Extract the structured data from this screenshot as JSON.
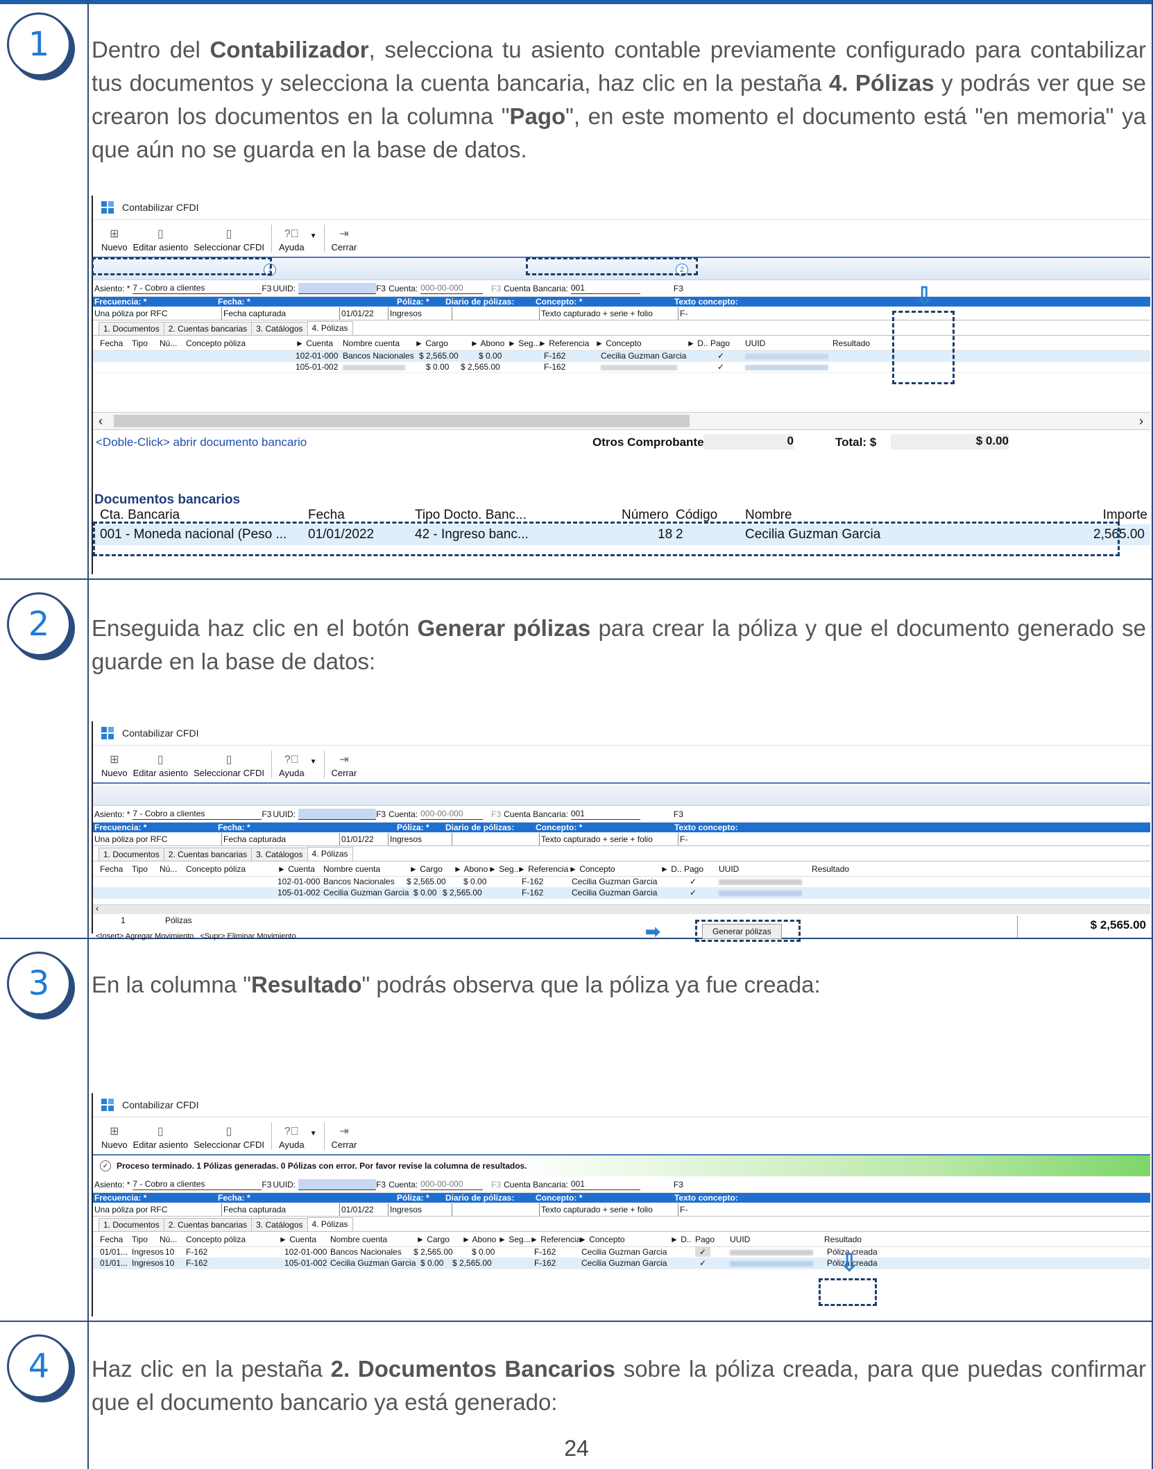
{
  "steps": [
    {
      "num": "1",
      "text_parts": [
        "Dentro del ",
        "Contabilizador",
        ", selecciona tu asiento contable previamente configurado para contabilizar tus documentos y selecciona la cuenta bancaria, haz clic en la pestaña ",
        "4. Pólizas",
        " y podrás ver que se crearon los documentos en la columna \"",
        "Pago",
        "\", en este momento el documento está \"en memoria\" ya que aún no se guarda en la base de datos."
      ]
    },
    {
      "num": "2",
      "text_parts": [
        " Enseguida haz clic en el botón ",
        "Generar pólizas",
        " para crear la póliza y que el documento generado se guarde en la base de datos:"
      ]
    },
    {
      "num": "3",
      "text_parts": [
        "En la columna \"",
        "Resultado",
        "\" podrás observa que la póliza ya fue creada:"
      ]
    },
    {
      "num": "4",
      "text_parts": [
        "Haz clic en la pestaña ",
        "2. Documentos Bancarios",
        " sobre la póliza creada, para que puedas confirmar que el documento bancario ya está generado:"
      ]
    }
  ],
  "page_number": "24",
  "window": {
    "title": "Contabilizar CFDI",
    "toolbar": [
      "Nuevo",
      "Editar asiento",
      "Seleccionar CFDI",
      "Ayuda",
      "Cerrar"
    ],
    "asiento_label": "Asiento: *",
    "asiento_value": "7 - Cobro a clientes",
    "f3": "F3",
    "uuid_label": "UUID:",
    "cuenta_label": "Cuenta:",
    "cuenta_value": "000-00-000",
    "cta_bancaria_label": "Cuenta Bancaria:",
    "cta_bancaria_value": "001",
    "hdr": [
      "Frecuencia: *",
      "Fecha: *",
      "Póliza: *",
      "Diario de pólizas:",
      "Concepto: *",
      "Texto concepto:"
    ],
    "frecuencia": "Una póliza por RFC",
    "fecha": "Fecha capturada",
    "fecha_val": "01/01/22",
    "poliza": "Ingresos",
    "concepto": "Texto capturado + serie + folio",
    "texto": "F-",
    "tabs": [
      "1. Documentos",
      "2. Cuentas bancarias",
      "3. Catálogos",
      "4. Pólizas"
    ],
    "cols": [
      "Fecha",
      "Tipo",
      "Nú...",
      "Concepto póliza",
      "► Cuenta",
      "Nombre cuenta",
      "► Cargo",
      "► Abono",
      "► Seg...",
      "► Referencia",
      "► Concepto",
      "► D..",
      "Pago",
      "UUID",
      "Resultado"
    ],
    "check": "✓",
    "rows1": [
      {
        "cuenta": "102-01-000",
        "nombre": "Bancos Nacionales",
        "cargo": "$ 2,565.00",
        "abono": "$ 0.00",
        "ref": "F-162",
        "concepto": "Cecilia Guzman Garcia"
      },
      {
        "cuenta": "105-01-002",
        "nombre": "",
        "cargo": "$ 0.00",
        "abono": "$ 2,565.00",
        "ref": "F-162",
        "concepto": ""
      }
    ],
    "rows2": [
      {
        "cuenta": "102-01-000",
        "nombre": "Bancos Nacionales",
        "cargo": "$ 2,565.00",
        "abono": "$ 0.00",
        "ref": "F-162",
        "concepto": "Cecilia Guzman Garcia"
      },
      {
        "cuenta": "105-01-002",
        "nombre": "Cecilia Guzman Garcia",
        "cargo": "$ 0.00",
        "abono": "$ 2,565.00",
        "ref": "F-162",
        "concepto": "Cecilia Guzman Garcia"
      }
    ],
    "rows3": [
      {
        "fecha": "01/01...",
        "tipo": "Ingresos",
        "num": "10",
        "cpol": "F-162",
        "cuenta": "102-01-000",
        "nombre": "Bancos Nacionales",
        "cargo": "$ 2,565.00",
        "abono": "$ 0.00",
        "ref": "F-162",
        "concepto": "Cecilia Guzman Garcia",
        "resultado": "Póliza creada"
      },
      {
        "fecha": "01/01...",
        "tipo": "Ingresos",
        "num": "10",
        "cpol": "F-162",
        "cuenta": "105-01-002",
        "nombre": "Cecilia Guzman Garcia",
        "cargo": "$ 0.00",
        "abono": "$ 2,565.00",
        "ref": "F-162",
        "concepto": "Cecilia Guzman Garcia",
        "resultado": "Póliza creada"
      }
    ],
    "doble_click": "<Doble-Click> abrir documento bancario",
    "otros": "Otros Comprobantes:",
    "otros_val": "0",
    "total": "Total: $",
    "total_val": "$ 0.00",
    "docs_title": "Documentos bancarios",
    "docs_cols": [
      "Cta. Bancaria",
      "Fecha",
      "Tipo Docto. Banc...",
      "Número",
      "Código",
      "Nombre",
      "Importe"
    ],
    "docs_row": [
      "001 - Moneda nacional (Peso ...",
      "01/01/2022",
      "42 - Ingreso banc...",
      "18",
      "2",
      "Cecilia Guzman Garcia",
      "2,565.00"
    ],
    "polizas_count": "1",
    "polizas_label": "Pólizas",
    "insert_help": "<Insert> Agregar Movimiento   <Supr> Eliminar Movimiento",
    "generar": "Generar pólizas",
    "total2": "$ 2,565.00",
    "msg": "Proceso terminado. 1 Pólizas generadas. 0 Pólizas con error. Por favor revise la columna de resultados."
  }
}
